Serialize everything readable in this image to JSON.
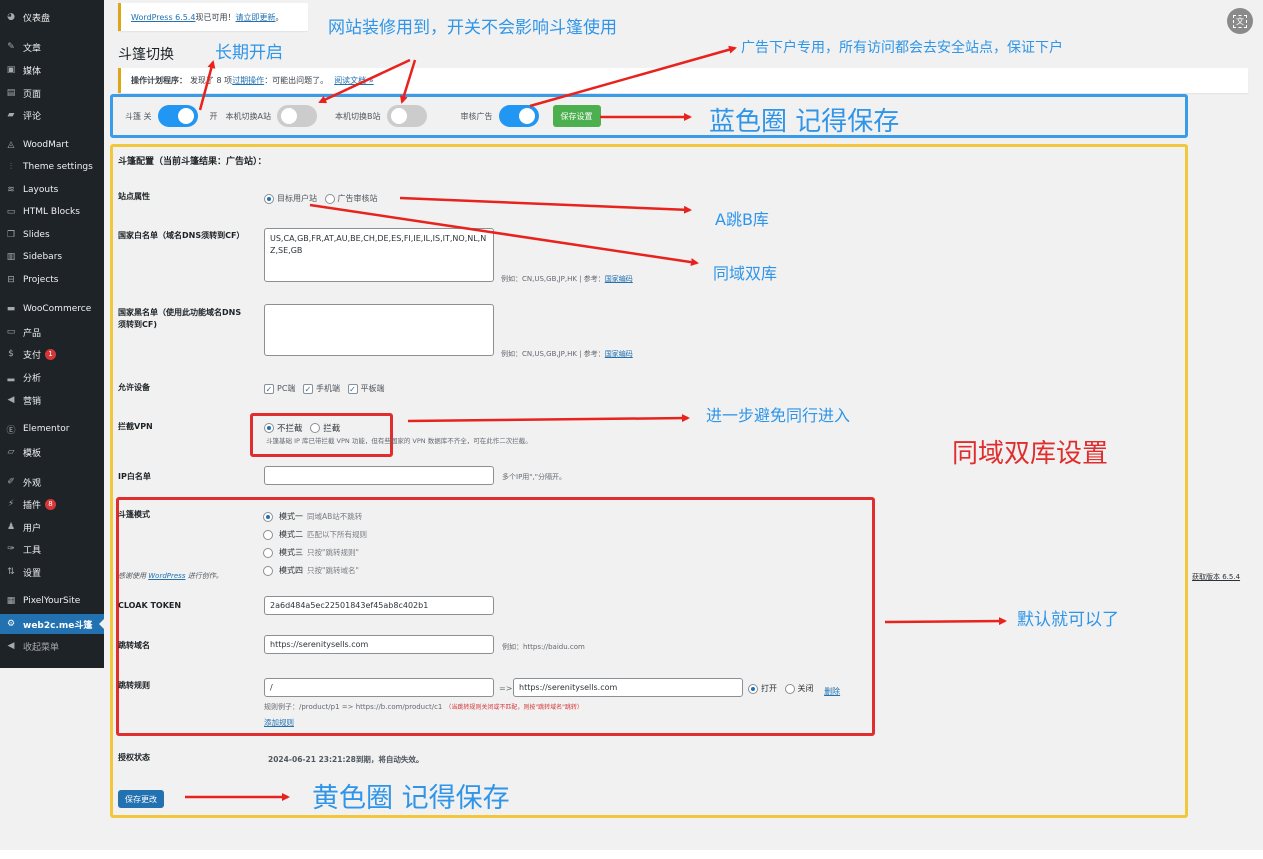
{
  "sidebar": {
    "items": [
      {
        "label": "仪表盘",
        "icon": "dashboard-icon",
        "glyph": "◕"
      },
      {
        "label": "文章",
        "icon": "pin-icon",
        "glyph": "✎"
      },
      {
        "label": "媒体",
        "icon": "media-icon",
        "glyph": "▣"
      },
      {
        "label": "页面",
        "icon": "pages-icon",
        "glyph": "▤"
      },
      {
        "label": "评论",
        "icon": "comments-icon",
        "glyph": "▰"
      },
      {
        "label": "WoodMart",
        "icon": "woodmart-icon",
        "glyph": "◬"
      },
      {
        "label": "Theme settings",
        "icon": "sliders-icon",
        "glyph": "⫶"
      },
      {
        "label": "Layouts",
        "icon": "layers-icon",
        "glyph": "≋"
      },
      {
        "label": "HTML Blocks",
        "icon": "html-block-icon",
        "glyph": "▭"
      },
      {
        "label": "Slides",
        "icon": "slides-icon",
        "glyph": "❐"
      },
      {
        "label": "Sidebars",
        "icon": "sidebars-icon",
        "glyph": "▥"
      },
      {
        "label": "Projects",
        "icon": "briefcase-icon",
        "glyph": "⊟"
      },
      {
        "label": "WooCommerce",
        "icon": "woocommerce-icon",
        "glyph": "▬"
      },
      {
        "label": "产品",
        "icon": "products-icon",
        "glyph": "▭"
      },
      {
        "label": "支付",
        "icon": "payments-icon",
        "glyph": "$",
        "badge": "1"
      },
      {
        "label": "分析",
        "icon": "analytics-icon",
        "glyph": "▂"
      },
      {
        "label": "营销",
        "icon": "megaphone-icon",
        "glyph": "◀"
      },
      {
        "label": "Elementor",
        "icon": "elementor-icon",
        "glyph": "Ⓔ"
      },
      {
        "label": "模板",
        "icon": "folder-icon",
        "glyph": "▱"
      },
      {
        "label": "外观",
        "icon": "brush-icon",
        "glyph": "✐"
      },
      {
        "label": "插件",
        "icon": "plugin-icon",
        "glyph": "⚡",
        "badge": "8"
      },
      {
        "label": "用户",
        "icon": "user-icon",
        "glyph": "♟"
      },
      {
        "label": "工具",
        "icon": "wrench-icon",
        "glyph": "✑"
      },
      {
        "label": "设置",
        "icon": "settings-icon",
        "glyph": "⇅"
      },
      {
        "label": "PixelYourSite",
        "icon": "pixelyoursite-icon",
        "glyph": "▦"
      },
      {
        "label": "web2c.me斗篷",
        "icon": "gear-icon",
        "glyph": "⚙",
        "active": true
      },
      {
        "label": "收起菜单",
        "icon": "collapse-icon",
        "glyph": "◀"
      }
    ]
  },
  "notices": {
    "update_version": "WordPress 6.5.4",
    "update_text": " 现已可用！",
    "update_link": "请立即更新",
    "update_end": "。",
    "cron_label": "操作计划程序：",
    "cron_text": "发现了 8 项",
    "cron_link": "过期操作",
    "cron_text2": "：可能出问题了。",
    "cron_doc_link": "阅读文档 »"
  },
  "page_title": "斗篷切换",
  "toggles": {
    "cloak_off_label": "斗篷 关",
    "cloak_on_label": "开",
    "cloak_on": true,
    "local_a_label": "本机切换A站",
    "local_a_on": false,
    "local_b_label": "本机切换B站",
    "local_b_on": false,
    "audit_ad_label": "审核广告",
    "audit_ad_on": true,
    "save_settings": "保存设置"
  },
  "config": {
    "heading": "斗篷配置（当前斗篷结果：广告站）：",
    "site_attr_label": "站点属性",
    "site_attr_options": [
      "目标用户站",
      "广告审核站"
    ],
    "site_attr_selected": "目标用户站",
    "whitelist_label": "国家白名单（域名DNS须转到CF）",
    "whitelist_value": "US,CA,GB,FR,AT,AU,BE,CH,DE,ES,FI,IE,IL,IS,IT,NO,NL,NZ,SE,GB",
    "country_hint": "例如：CN,US,GB,JP,HK | 参考：",
    "country_hint_link": "国家编码",
    "blacklist_label": "国家黑名单（使用此功能域名DNS须转到CF)",
    "blacklist_value": "",
    "devices_label": "允许设备",
    "devices": [
      {
        "label": "PC端",
        "checked": true
      },
      {
        "label": "手机端",
        "checked": true
      },
      {
        "label": "平板端",
        "checked": true
      }
    ],
    "vpn_label": "拦截VPN",
    "vpn_options": [
      "不拦截",
      "拦截"
    ],
    "vpn_selected": "不拦截",
    "vpn_hint": "斗篷基础 IP 库已带拦截 VPN 功能，但有些国家的 VPN 数据库不齐全，可在此作二次拦截。",
    "ip_whitelist_label": "IP白名单",
    "ip_whitelist_value": "",
    "ip_whitelist_hint": "多个IP用\",\"分隔开。",
    "mode_label": "斗篷模式",
    "modes": [
      {
        "name": "模式一",
        "desc": "同域AB站不跳转",
        "checked": true
      },
      {
        "name": "模式二",
        "desc": "匹配以下所有规则",
        "checked": false
      },
      {
        "name": "模式三",
        "desc": "只按\"跳转规则\"",
        "checked": false
      },
      {
        "name": "模式四",
        "desc": "只按\"跳转域名\"",
        "checked": false
      }
    ],
    "token_label": "CLOAK TOKEN",
    "token_value": "2a6d484a5ec22501843ef45ab8c402b1",
    "redirect_domain_label": "跳转域名",
    "redirect_domain_value": "https://serenitysells.com",
    "redirect_domain_hint": "例如：https://baidu.com",
    "redirect_rule_label": "跳转规则",
    "rule_from": "/",
    "rule_arrow": "=>",
    "rule_to": "https://serenitysells.com",
    "rule_options": [
      "打开",
      "关闭"
    ],
    "rule_selected": "打开",
    "rule_delete": "删除",
    "rule_example": "规则例子：/product/p1 => https://b.com/product/c1",
    "rule_example_warn": "（当跳转规则关闭或不匹配，则按\"跳转域名\"跳转）",
    "add_rule": "添加规则",
    "license_label": "授权状态",
    "license_value": "2024-06-21 23:21:28到期，将自动失效。",
    "save_changes": "保存更改"
  },
  "footer": {
    "credit_prefix": "感谢使用 ",
    "credit_link": "WordPress",
    "credit_suffix": " 进行创作。",
    "version_link": "获取版本 6.5.4"
  },
  "annotations": {
    "decor_note": "网站装修用到，开关不会影响斗篷使用",
    "long_on": "长期开启",
    "ad_note": "广告下户专用，所有访问都会去安全站点，保证下户",
    "blue_save": "蓝色圈 记得保存",
    "a_to_b": "A跳B库",
    "same_domain": "同域双库",
    "avoid_peers": "进一步避免同行进入",
    "same_domain_settings": "同域双库设置",
    "default_ok": "默认就可以了",
    "yellow_save": "黄色圈  记得保存"
  },
  "translate_icon": "文"
}
